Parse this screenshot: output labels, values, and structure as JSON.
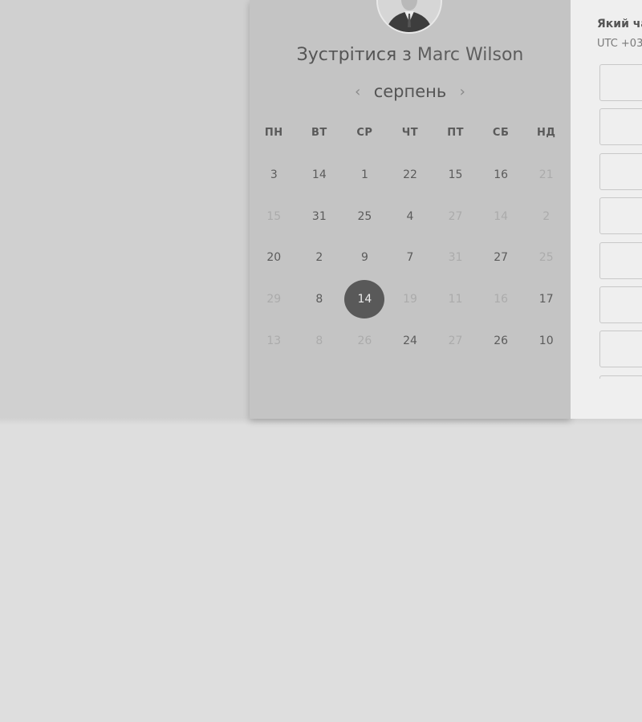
{
  "host": {
    "title_prefix": "Зустрітися з",
    "name": "Marc Wilson"
  },
  "calendar": {
    "month": "серпень",
    "weekdays": [
      "ПН",
      "ВТ",
      "СР",
      "ЧТ",
      "ПТ",
      "СБ",
      "НД"
    ],
    "days": [
      {
        "label": "3",
        "muted": false
      },
      {
        "label": "14",
        "muted": false
      },
      {
        "label": "1",
        "muted": false
      },
      {
        "label": "22",
        "muted": false
      },
      {
        "label": "15",
        "muted": false
      },
      {
        "label": "16",
        "muted": false
      },
      {
        "label": "21",
        "muted": true
      },
      {
        "label": "15",
        "muted": true
      },
      {
        "label": "31",
        "muted": false
      },
      {
        "label": "25",
        "muted": false
      },
      {
        "label": "4",
        "muted": false
      },
      {
        "label": "27",
        "muted": true
      },
      {
        "label": "14",
        "muted": true
      },
      {
        "label": "2",
        "muted": true
      },
      {
        "label": "20",
        "muted": false
      },
      {
        "label": "2",
        "muted": false
      },
      {
        "label": "9",
        "muted": false
      },
      {
        "label": "7",
        "muted": false
      },
      {
        "label": "31",
        "muted": true
      },
      {
        "label": "27",
        "muted": false
      },
      {
        "label": "25",
        "muted": true
      },
      {
        "label": "29",
        "muted": true
      },
      {
        "label": "8",
        "muted": false
      },
      {
        "label": "14",
        "muted": false,
        "selected": true
      },
      {
        "label": "19",
        "muted": true
      },
      {
        "label": "11",
        "muted": true
      },
      {
        "label": "16",
        "muted": true
      },
      {
        "label": "17",
        "muted": false
      },
      {
        "label": "13",
        "muted": true
      },
      {
        "label": "8",
        "muted": true
      },
      {
        "label": "26",
        "muted": true
      },
      {
        "label": "24",
        "muted": false
      },
      {
        "label": "27",
        "muted": true
      },
      {
        "label": "26",
        "muted": false
      },
      {
        "label": "10",
        "muted": false
      }
    ]
  },
  "time_panel": {
    "heading": "Який ча",
    "timezone": "UTC +03"
  },
  "icons": {
    "prev": "chevron-left-icon",
    "next": "chevron-right-icon"
  },
  "colors": {
    "selected_day": "#595959",
    "background": "#dedede"
  }
}
